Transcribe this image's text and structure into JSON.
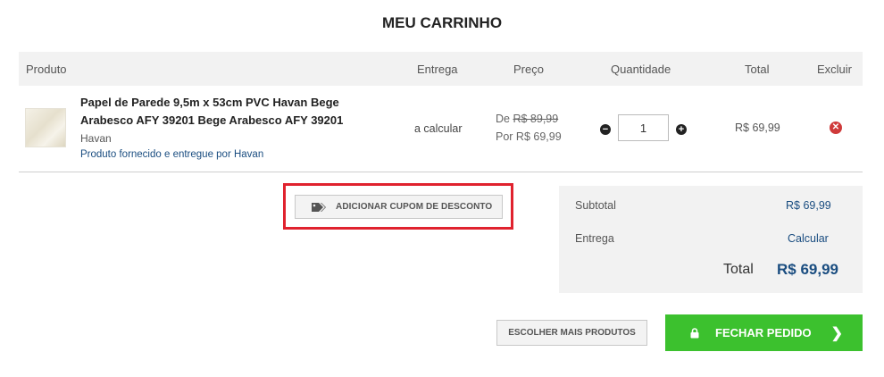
{
  "page_title": "MEU CARRINHO",
  "table_headers": {
    "produto": "Produto",
    "entrega": "Entrega",
    "preco": "Preço",
    "quantidade": "Quantidade",
    "total": "Total",
    "excluir": "Excluir"
  },
  "cart_item": {
    "name": "Papel de Parede 9,5m x 53cm PVC Havan Bege Arabesco AFY 39201 Bege Arabesco AFY 39201",
    "brand": "Havan",
    "seller": "Produto fornecido e entregue por Havan",
    "shipping": "a calcular",
    "price_old_prefix": "De",
    "price_old": "R$ 89,99",
    "price_new": "Por R$ 69,99",
    "quantity": "1",
    "total": "R$ 69,99",
    "minus_icon": "minus-circle-icon",
    "plus_icon": "plus-circle-icon",
    "remove_icon": "remove-circle-icon"
  },
  "coupon": {
    "label": "ADICIONAR CUPOM DE DESCONTO",
    "icon": "tags-icon",
    "highlight_color": "#e0222e"
  },
  "summary": {
    "subtotal_label": "Subtotal",
    "subtotal_value": "R$ 69,99",
    "entrega_label": "Entrega",
    "entrega_value": "Calcular",
    "total_label": "Total",
    "total_value": "R$ 69,99"
  },
  "actions": {
    "more_products": "ESCOLHER MAIS PRODUTOS",
    "checkout": "FECHAR PEDIDO",
    "checkout_color": "#3cc12e"
  },
  "colors": {
    "link_blue": "#1a4d80",
    "remove_red": "#cf3a3a"
  }
}
